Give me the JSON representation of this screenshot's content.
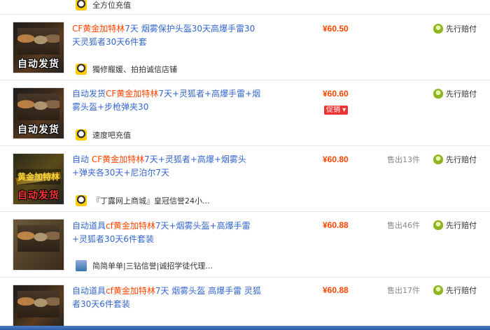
{
  "top_partial": {
    "seller": "全方位充值"
  },
  "listings": [
    {
      "thumb_stamp": "自动发货",
      "title_prefix": "",
      "title_highlight": "CF黄金加特林",
      "title_suffix": "7天 烟雾保护头盔30天高爆手雷30天灵狐者30天6件套",
      "seller": "獨修寵媛、拍拍诚信店铺",
      "price": "¥60.50",
      "promo": "",
      "sold": "",
      "guarantee": "先行赔付"
    },
    {
      "thumb_stamp": "自动发货",
      "title_prefix": "自动发货",
      "title_highlight": "CF黄金加特林",
      "title_suffix": "7天+灵狐者+高爆手雷+烟雾头盔+步枪弹夹30",
      "seller": "速度吧充值",
      "price": "¥60.60",
      "promo": "促销 ▾",
      "sold": "",
      "guarantee": "先行赔付"
    },
    {
      "thumb_stamp": "自动发货",
      "thumb_gold": "黄金加特林",
      "title_prefix": "自动 ",
      "title_highlight": "CF黄金加特林",
      "title_suffix": "7天+灵狐者+高爆+烟雾头+弹夹各30天+尼泊尔7天",
      "seller": "『丁露网上商城』皇冠信誉24小...",
      "price": "¥60.80",
      "promo": "",
      "sold": "售出13件",
      "guarantee": "先行赔付"
    },
    {
      "thumb_stamp": "",
      "title_prefix": "自动道具",
      "title_highlight": "cf黄金加特林",
      "title_suffix": "7天+烟雾头盔+高爆手雷+灵狐者30天6件套装",
      "seller": "简简单单|三钻信誉|诚招学徒代理...",
      "price": "¥60.88",
      "promo": "",
      "sold": "售出46件",
      "guarantee": "先行赔付"
    },
    {
      "thumb_stamp": "",
      "title_prefix": "自动道具",
      "title_highlight": "cf黄金加特林",
      "title_suffix": "7天 烟雾头盔 高爆手雷 灵狐者30天6件套装",
      "seller": "",
      "price": "¥60.88",
      "promo": "",
      "sold": "售出17件",
      "guarantee": "先行赔付"
    }
  ],
  "icons": {
    "seller_icon": "qq-icon",
    "seller_icon_alt": "wangwang-icon",
    "guarantee_icon": "shield-icon"
  },
  "colors": {
    "price": "#ff4400",
    "highlight": "#ff4400",
    "link": "#3366cc",
    "promo": "#ee3333"
  }
}
